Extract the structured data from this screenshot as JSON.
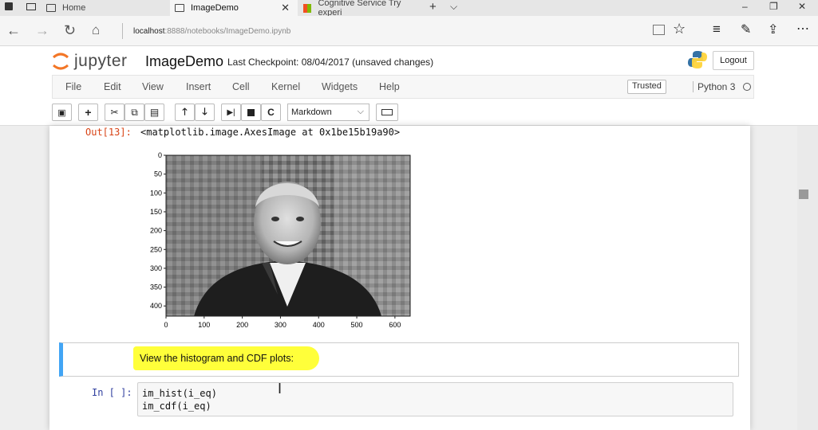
{
  "browser": {
    "tabs": [
      {
        "label": "Home"
      },
      {
        "label": "ImageDemo"
      },
      {
        "label": "Cognitive Service Try experi"
      }
    ],
    "url_host": "localhost",
    "url_rest": ":8888/notebooks/ImageDemo.ipynb"
  },
  "jupyter": {
    "logo_text": "jupyter",
    "notebook_name": "ImageDemo",
    "checkpoint": "Last Checkpoint: 08/04/2017 (unsaved changes)",
    "logout_label": "Logout",
    "menus": [
      "File",
      "Edit",
      "View",
      "Insert",
      "Cell",
      "Kernel",
      "Widgets",
      "Help"
    ],
    "trusted_label": "Trusted",
    "kernel_name": "Python 3",
    "cell_type": "Markdown"
  },
  "cells": {
    "out_prompt": "Out[13]:",
    "out_text": "<matplotlib.image.AxesImage at 0x1be15b19a90>",
    "markdown_text": "View the histogram and CDF plots:",
    "in_prompt": "In [ ]:",
    "code_line1": "im_hist(i_eq)",
    "code_line2": "im_cdf(i_eq)"
  },
  "chart_data": {
    "type": "image",
    "xticks": [
      "0",
      "100",
      "200",
      "300",
      "400",
      "500",
      "600"
    ],
    "yticks": [
      "0",
      "50",
      "100",
      "150",
      "200",
      "250",
      "300",
      "350",
      "400"
    ],
    "xlim": [
      0,
      640
    ],
    "ylim": [
      0,
      427
    ]
  }
}
